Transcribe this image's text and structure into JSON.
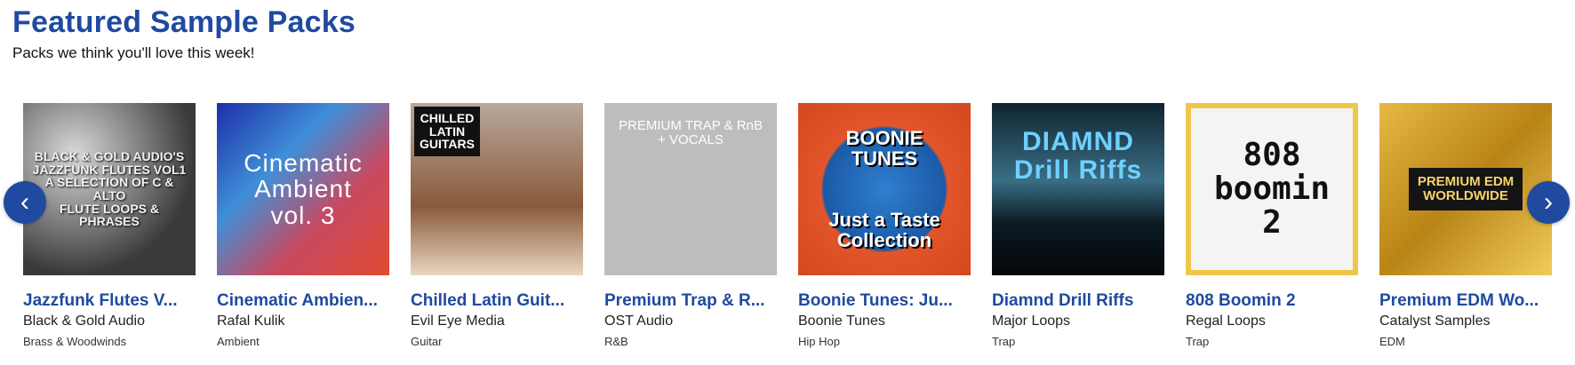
{
  "section": {
    "title": "Featured Sample Packs",
    "subtitle": "Packs we think you'll love this week!"
  },
  "nav": {
    "prev_glyph": "‹",
    "next_glyph": "›"
  },
  "packs": [
    {
      "title": "Jazzfunk Flutes V...",
      "label": "Black & Gold Audio",
      "genre": "Brass & Woodwinds",
      "cover_text": "BLACK & GOLD AUDIO'S\nJAZZFUNK FLUTES VOL1\nA SELECTION OF C & ALTO\nFLUTE LOOPS & PHRASES"
    },
    {
      "title": "Cinematic Ambien...",
      "label": "Rafal Kulik",
      "genre": "Ambient",
      "cover_text": "Cinematic\nAmbient\nvol. 3"
    },
    {
      "title": "Chilled Latin Guit...",
      "label": "Evil Eye Media",
      "genre": "Guitar",
      "cover_text": "CHILLED\nLATIN\nGUITARS"
    },
    {
      "title": "Premium Trap & R...",
      "label": "OST Audio",
      "genre": "R&B",
      "cover_text": "PREMIUM TRAP & RnB\n+ VOCALS"
    },
    {
      "title": "Boonie Tunes: Ju...",
      "label": "Boonie Tunes",
      "genre": "Hip Hop",
      "cover_text": "BOONIE\nTUNES\n\n\nJust a Taste\nCollection"
    },
    {
      "title": "Diamnd Drill Riffs",
      "label": "Major Loops",
      "genre": "Trap",
      "cover_text": "DIAMND\nDrill Riffs"
    },
    {
      "title": "808 Boomin 2",
      "label": "Regal Loops",
      "genre": "Trap",
      "cover_text": "808\nboomin\n2"
    },
    {
      "title": "Premium EDM Wo...",
      "label": "Catalyst Samples",
      "genre": "EDM",
      "cover_text": "PREMIUM EDM\nWORLDWIDE"
    }
  ]
}
